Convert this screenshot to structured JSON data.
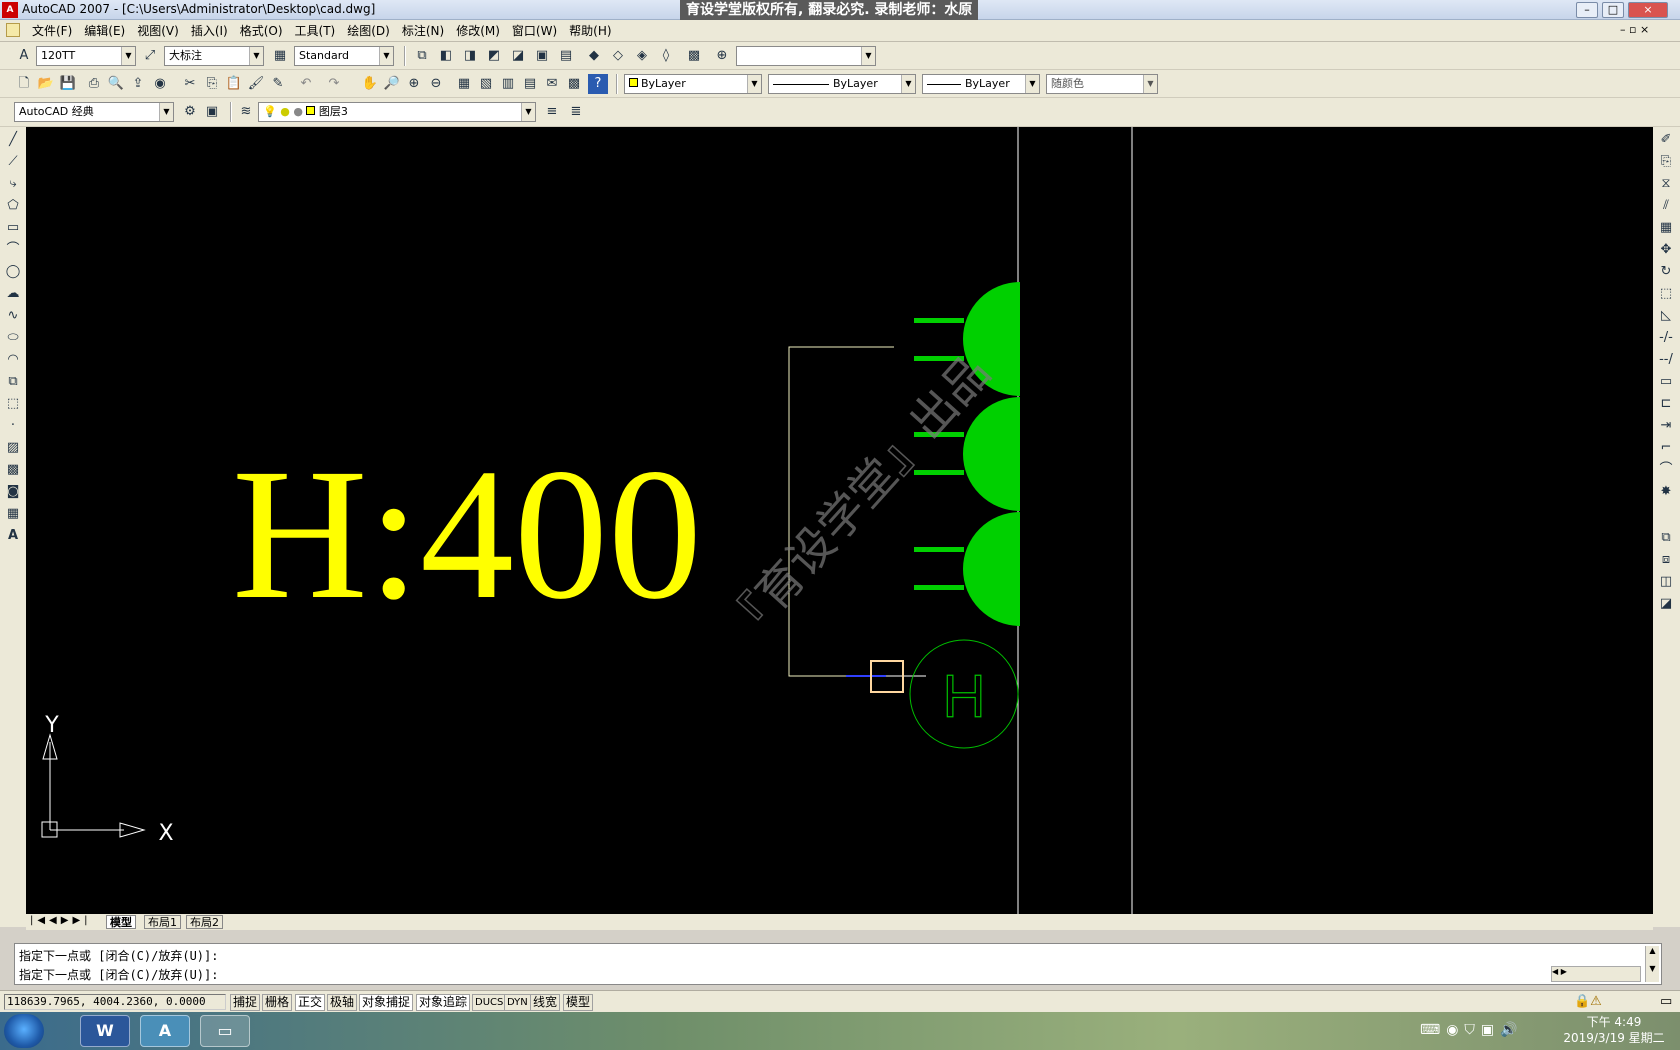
{
  "window": {
    "app_icon": "A",
    "title": "AutoCAD 2007 - [C:\\Users\\Administrator\\Desktop\\cad.dwg]",
    "banner": "育设学堂版权所有, 翻录必究. 录制老师：水原",
    "min": "–",
    "max": "□",
    "close": "×"
  },
  "menu": [
    "文件(F)",
    "编辑(E)",
    "视图(V)",
    "插入(I)",
    "格式(O)",
    "工具(T)",
    "绘图(D)",
    "标注(N)",
    "修改(M)",
    "窗口(W)",
    "帮助(H)"
  ],
  "toolbar1": {
    "text_style": "120TT",
    "dim_style": "大标注",
    "table_style": "Standard",
    "blank_combo": ""
  },
  "toolbar2": {
    "color": "ByLayer",
    "linetype": "ByLayer",
    "lineweight": "ByLayer",
    "plotstyle": "随颜色"
  },
  "toolbar3": {
    "workspace": "AutoCAD 经典",
    "layer": "图层3"
  },
  "drawing": {
    "big_text": "H:400",
    "bubble_text": "H",
    "watermark": "『育设学堂』出品",
    "ucs_y": "Y",
    "ucs_x": "X"
  },
  "tabs": [
    "模型",
    "布局1",
    "布局2"
  ],
  "command": {
    "line1": "指定下一点或 [闭合(C)/放弃(U)]:",
    "line2": "指定下一点或 [闭合(C)/放弃(U)]:"
  },
  "status": {
    "coords": "118639.7965, 4004.2360, 0.0000",
    "buttons": [
      "捕捉",
      "栅格",
      "正交",
      "极轴",
      "对象捕捉",
      "对象追踪",
      "DUCS",
      "DYN",
      "线宽",
      "模型"
    ]
  },
  "taskbar": {
    "apps": [
      "W",
      "A",
      "▭"
    ],
    "time": "下午 4:49",
    "date": "2019/3/19 星期二"
  },
  "colors": {
    "canvas": "#000000",
    "text_yellow": "#ffff00",
    "fill_green": "#00cc00",
    "line_white": "#ffffff"
  }
}
